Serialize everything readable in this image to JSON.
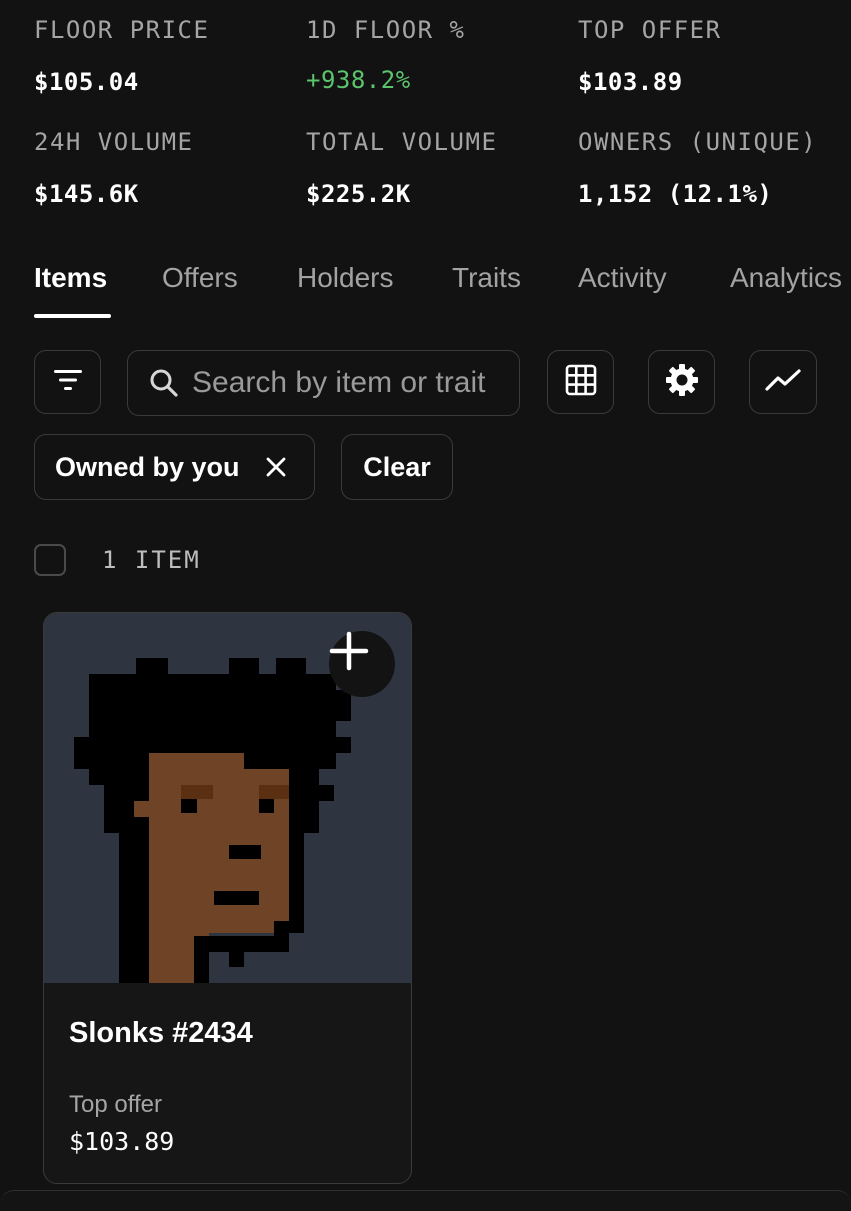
{
  "stats": [
    {
      "label": "FLOOR PRICE",
      "value": "$105.04"
    },
    {
      "label": "1D FLOOR %",
      "value": "+938.2%"
    },
    {
      "label": "TOP OFFER",
      "value": "$103.89"
    },
    {
      "label": "24H VOLUME",
      "value": "$145.6K"
    },
    {
      "label": "TOTAL VOLUME",
      "value": "$225.2K"
    },
    {
      "label": "OWNERS (UNIQUE)",
      "value": "1,152 (12.1%)"
    }
  ],
  "colors": {
    "positive": "#5cc46d",
    "background": "#121212",
    "card_bg": "#2e3541"
  },
  "tabs": [
    {
      "label": "Items",
      "active": true
    },
    {
      "label": "Offers"
    },
    {
      "label": "Holders"
    },
    {
      "label": "Traits"
    },
    {
      "label": "Activity"
    },
    {
      "label": "Analytics"
    }
  ],
  "toolbar": {
    "filter_icon": "filter-icon",
    "search_placeholder": "Search by item or trait",
    "grid_icon": "grid-icon",
    "settings_icon": "gear-icon",
    "chart_icon": "trend-chart-icon"
  },
  "chips": {
    "owned": "Owned by you",
    "clear": "Clear"
  },
  "results": {
    "count_label": "1 ITEM"
  },
  "item": {
    "name": "Slonks #2434",
    "offer_label": "Top offer",
    "offer_value": "$103.89"
  }
}
